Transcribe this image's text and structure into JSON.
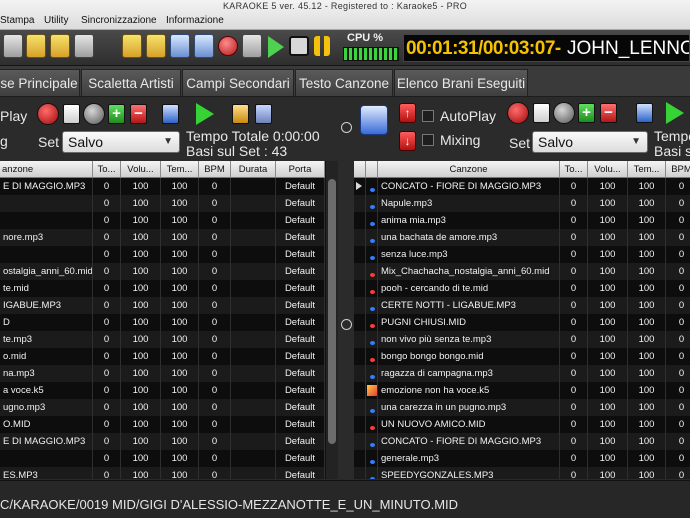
{
  "window": {
    "title": "KARAOKE 5   ver. 45.12 - Registered to : Karaoke5 - PRO"
  },
  "menu": [
    "Stampa",
    "Utility",
    "Sincronizzazione",
    "Informazione"
  ],
  "toolbar": {
    "icons": [
      "settings-icon",
      "list-icon",
      "music-file-icon",
      "printer-icon",
      "folder-icon",
      "star-icon",
      "flag-icon",
      "sheet-icon",
      "video-icon",
      "no-entry-icon",
      "play-icon",
      "stop-icon",
      "pause-icon"
    ],
    "cpu_label": "CPU %",
    "timer_time": "00:01:31/00:03:07-",
    "timer_song": "JOHN_LENNON"
  },
  "tabs": [
    "se Principale",
    "Scaletta Artisti",
    "Campi Secondari",
    "Testo Canzone",
    "Elenco Brani Eseguiti"
  ],
  "left_panel": {
    "play_label": "Play",
    "mix_label": "g",
    "set_label": "Set",
    "set_value": "Salvo",
    "tempo_totale": "Tempo Totale  0:00:00",
    "basi_sul_set": "Basi sul Set : 43"
  },
  "right_panel": {
    "autoplay_label": "AutoPlay",
    "mixing_label": "Mixing",
    "set_label": "Set",
    "set_value": "Salvo",
    "tempo_label": "Tempo",
    "basi_label": "Basi sul"
  },
  "left_table": {
    "headers": [
      "anzone",
      "To...",
      "Volu...",
      "Tem...",
      "BPM",
      "Durata",
      "Porta"
    ],
    "rows": [
      [
        "E DI MAGGIO.MP3",
        "0",
        "100",
        "100",
        "0",
        "",
        "Default"
      ],
      [
        "",
        "0",
        "100",
        "100",
        "0",
        "",
        "Default"
      ],
      [
        "",
        "0",
        "100",
        "100",
        "0",
        "",
        "Default"
      ],
      [
        "nore.mp3",
        "0",
        "100",
        "100",
        "0",
        "",
        "Default"
      ],
      [
        "",
        "0",
        "100",
        "100",
        "0",
        "",
        "Default"
      ],
      [
        "ostalgia_anni_60.mid",
        "0",
        "100",
        "100",
        "0",
        "",
        "Default"
      ],
      [
        "te.mid",
        "0",
        "100",
        "100",
        "0",
        "",
        "Default"
      ],
      [
        "IGABUE.MP3",
        "0",
        "100",
        "100",
        "0",
        "",
        "Default"
      ],
      [
        "D",
        "0",
        "100",
        "100",
        "0",
        "",
        "Default"
      ],
      [
        "te.mp3",
        "0",
        "100",
        "100",
        "0",
        "",
        "Default"
      ],
      [
        "o.mid",
        "0",
        "100",
        "100",
        "0",
        "",
        "Default"
      ],
      [
        "na.mp3",
        "0",
        "100",
        "100",
        "0",
        "",
        "Default"
      ],
      [
        "a voce.k5",
        "0",
        "100",
        "100",
        "0",
        "",
        "Default"
      ],
      [
        "ugno.mp3",
        "0",
        "100",
        "100",
        "0",
        "",
        "Default"
      ],
      [
        "O.MID",
        "0",
        "100",
        "100",
        "0",
        "",
        "Default"
      ],
      [
        "E DI MAGGIO.MP3",
        "0",
        "100",
        "100",
        "0",
        "",
        "Default"
      ],
      [
        "",
        "0",
        "100",
        "100",
        "0",
        "",
        "Default"
      ],
      [
        "ES.MP3",
        "0",
        "100",
        "100",
        "0",
        "",
        "Default"
      ]
    ]
  },
  "right_table": {
    "headers": [
      "Canzone",
      "To...",
      "Volu...",
      "Tem...",
      "BPM"
    ],
    "rows": [
      {
        "icon": "blue",
        "name": "CONCATO - FIORE DI MAGGIO.MP3",
        "values": [
          "0",
          "100",
          "100",
          "0"
        ]
      },
      {
        "icon": "blue",
        "name": "Napule.mp3",
        "values": [
          "0",
          "100",
          "100",
          "0"
        ]
      },
      {
        "icon": "blue",
        "name": "anima mia.mp3",
        "values": [
          "0",
          "100",
          "100",
          "0"
        ]
      },
      {
        "icon": "blue",
        "name": "una bachata de amore.mp3",
        "values": [
          "0",
          "100",
          "100",
          "0"
        ]
      },
      {
        "icon": "blue",
        "name": "senza luce.mp3",
        "values": [
          "0",
          "100",
          "100",
          "0"
        ]
      },
      {
        "icon": "red",
        "name": "Mix_Chachacha_nostalgia_anni_60.mid",
        "values": [
          "0",
          "100",
          "100",
          "0"
        ]
      },
      {
        "icon": "red",
        "name": "pooh - cercando di te.mid",
        "values": [
          "0",
          "100",
          "100",
          "0"
        ]
      },
      {
        "icon": "blue",
        "name": "CERTE NOTTI - LIGABUE.MP3",
        "values": [
          "0",
          "100",
          "100",
          "0"
        ]
      },
      {
        "icon": "red",
        "name": "PUGNI CHIUSI.MID",
        "values": [
          "0",
          "100",
          "100",
          "0"
        ]
      },
      {
        "icon": "blue",
        "name": "non vivo più senza te.mp3",
        "values": [
          "0",
          "100",
          "100",
          "0"
        ]
      },
      {
        "icon": "red",
        "name": "bongo bongo bongo.mid",
        "values": [
          "0",
          "100",
          "100",
          "0"
        ]
      },
      {
        "icon": "blue",
        "name": "ragazza di campagna.mp3",
        "values": [
          "0",
          "100",
          "100",
          "0"
        ]
      },
      {
        "icon": "k5",
        "name": "emozione non ha voce.k5",
        "values": [
          "0",
          "100",
          "100",
          "0"
        ]
      },
      {
        "icon": "blue",
        "name": "una carezza in un pugno.mp3",
        "values": [
          "0",
          "100",
          "100",
          "0"
        ]
      },
      {
        "icon": "red",
        "name": "UN NUOVO AMICO.MID",
        "values": [
          "0",
          "100",
          "100",
          "0"
        ]
      },
      {
        "icon": "blue",
        "name": "CONCATO - FIORE DI MAGGIO.MP3",
        "values": [
          "0",
          "100",
          "100",
          "0"
        ]
      },
      {
        "icon": "blue",
        "name": "generale.mp3",
        "values": [
          "0",
          "100",
          "100",
          "0"
        ]
      },
      {
        "icon": "blue",
        "name": "SPEEDYGONZALES.MP3",
        "values": [
          "0",
          "100",
          "100",
          "0"
        ]
      }
    ]
  },
  "status": {
    "path": "C/KARAOKE/0019 MID/GIGI D'ALESSIO-MEZZANOTTE_E_UN_MINUTO.MID"
  }
}
